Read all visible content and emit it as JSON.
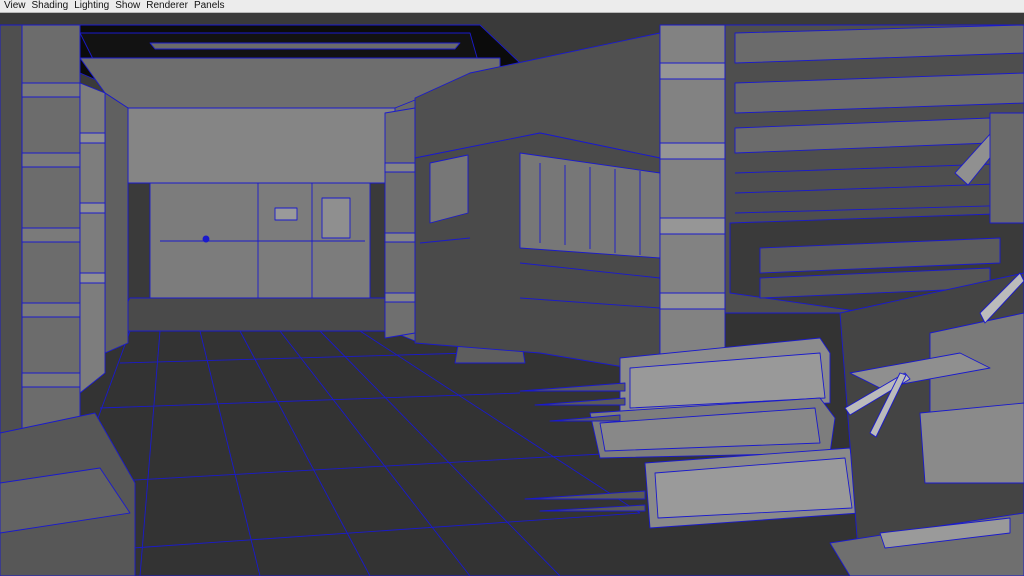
{
  "menubar": {
    "items": [
      "View",
      "Shading",
      "Lighting",
      "Show",
      "Renderer",
      "Panels"
    ]
  },
  "viewport": {
    "shading_mode": "wireframe-on-shaded",
    "colors": {
      "surface": "#5a5a5a",
      "surface_light": "#8a8a8a",
      "surface_dark": "#2c2c2c",
      "wireframe": "#1a1acc",
      "void": "#0b0b0b",
      "floor": "#333333"
    }
  }
}
